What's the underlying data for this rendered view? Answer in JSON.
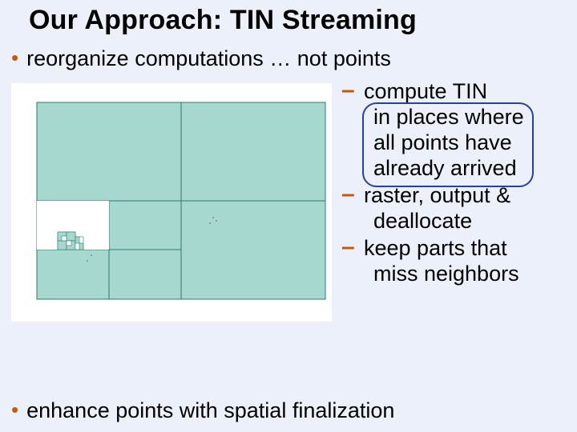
{
  "title": "Our Approach: TIN Streaming",
  "bullets": {
    "main1": "reorganize computations … not points",
    "main2": "enhance points with spatial finalization"
  },
  "sub": {
    "item1": {
      "l1": "compute TIN",
      "l2": "in places where",
      "l3": "all points have",
      "l4": "already arrived"
    },
    "item2": {
      "l1": "raster, output &",
      "l2": "deallocate"
    },
    "item3": {
      "l1": "keep parts that",
      "l2": "miss neighbors"
    }
  }
}
